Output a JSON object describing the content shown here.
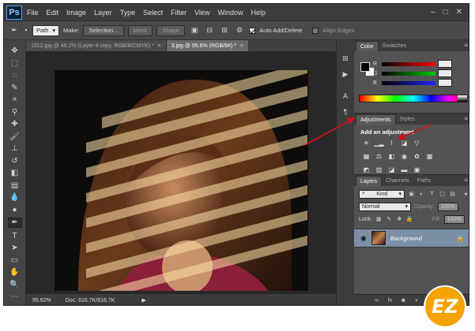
{
  "menubar": {
    "logo": "Ps",
    "items": [
      "File",
      "Edit",
      "Image",
      "Layer",
      "Type",
      "Select",
      "Filter",
      "View",
      "Window",
      "Help"
    ],
    "window_controls": [
      "–",
      "□",
      "✕"
    ]
  },
  "options_bar": {
    "mode_select": "Path",
    "make_label": "Make:",
    "selection_btn": "Selection...",
    "mask_btn": "Mask",
    "shape_btn": "Shape",
    "auto_add_delete_label": "Auto Add/Delete",
    "auto_add_delete_checked": true,
    "align_edges_label": "Align Edges",
    "align_edges_checked": false
  },
  "tabs": [
    {
      "label": "1312.jpg @ 49.2% (Layer 4 copy, RGB/8/CMYK) *",
      "active": false
    },
    {
      "label": "3.jpg @ 95.6% (RGB/8#) *",
      "active": true
    }
  ],
  "status": {
    "zoom": "95.62%",
    "doc": "Doc: 616.7K/616.7K"
  },
  "color_panel": {
    "tabs": [
      "Color",
      "Swatches"
    ],
    "channels": [
      {
        "key": "R",
        "color": "#d02020"
      },
      {
        "key": "G",
        "color": "#20a020"
      },
      {
        "key": "B",
        "color": "#2040d0"
      }
    ]
  },
  "adjustments_panel": {
    "tabs": [
      "Adjustments",
      "Styles"
    ],
    "title": "Add an adjustment",
    "icons_row1": [
      "brightness-icon",
      "levels-icon",
      "curves-icon",
      "exposure-icon",
      "vibrance-icon"
    ],
    "icons_row2": [
      "hue-sat-icon",
      "color-balance-icon",
      "bw-icon",
      "photo-filter-icon",
      "channel-mixer-icon",
      "color-lookup-icon"
    ],
    "icons_row3": [
      "invert-icon",
      "posterize-icon",
      "threshold-icon",
      "gradient-map-icon",
      "selective-color-icon"
    ]
  },
  "layers_panel": {
    "tabs": [
      "Layers",
      "Channels",
      "Paths"
    ],
    "kind_label": "Kind",
    "blend_mode": "Normal",
    "opacity_label": "Opacity:",
    "opacity_value": "100%",
    "lock_label": "Lock:",
    "fill_label": "Fill:",
    "fill_value": "100%",
    "layer_name": "Background"
  },
  "watermark": {
    "text": "EZ"
  },
  "accent": {
    "arrow": "#d0101c",
    "selected_layer": "#7d8fa6"
  }
}
